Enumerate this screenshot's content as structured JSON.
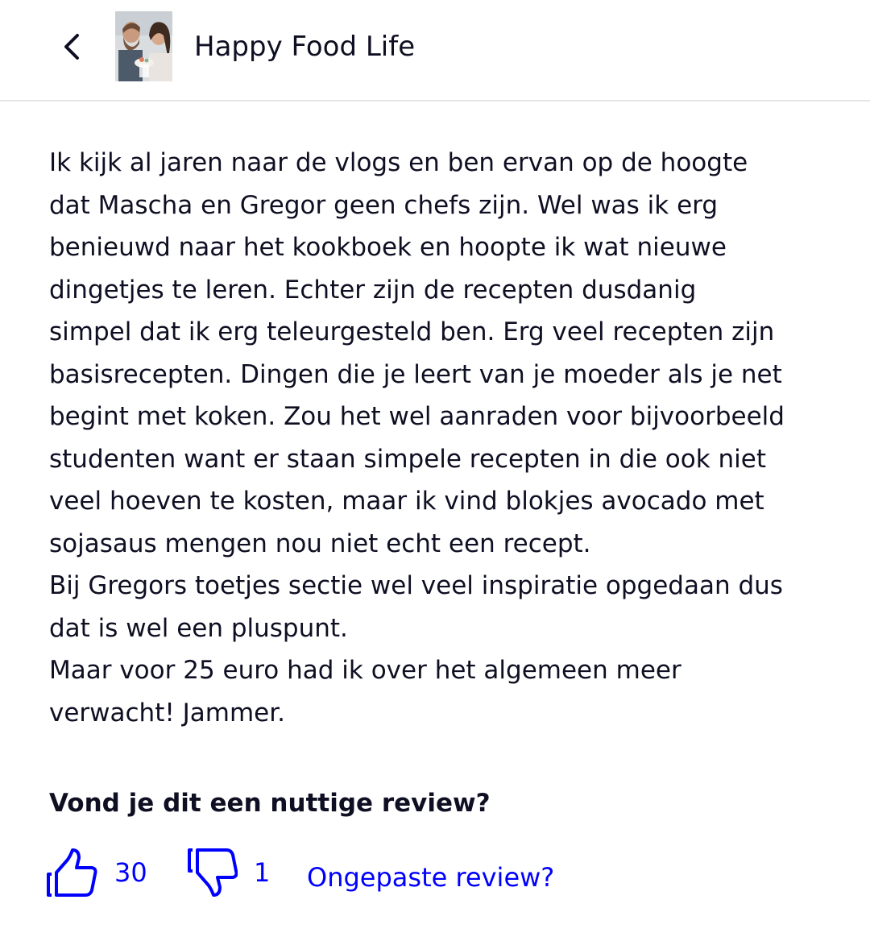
{
  "header": {
    "back_icon": "chevron-left-icon",
    "book_title": "Happy Food Life"
  },
  "review": {
    "lines": [
      "Ik kijk al jaren naar de vlogs en ben ervan op de hoogte",
      "dat Mascha en Gregor geen chefs zijn. Wel was ik erg",
      "benieuwd naar het kookboek en hoopte ik wat nieuwe",
      "dingetjes te leren. Echter zijn de recepten dusdanig",
      "simpel dat ik erg teleurgesteld ben. Erg veel recepten zijn",
      "basisrecepten. Dingen die je leert van je moeder als je net",
      "begint met koken. Zou het wel aanraden voor bijvoorbeeld",
      "studenten want er staan simpele recepten in die ook niet",
      "veel hoeven te kosten, maar ik vind blokjes avocado met",
      "sojasaus mengen nou niet echt een recept.",
      "Bij Gregors toetjes sectie wel veel inspiratie opgedaan dus",
      "dat is wel een pluspunt.",
      "Maar voor 25 euro had ik over het algemeen meer",
      "verwacht! Jammer."
    ]
  },
  "feedback": {
    "question": "Vond je dit een nuttige review?",
    "thumbs_up_icon": "thumbs-up-icon",
    "thumbs_down_icon": "thumbs-down-icon",
    "upvotes": "30",
    "downvotes": "1",
    "report_label": "Ongepaste review?"
  },
  "colors": {
    "text": "#0f0f23",
    "link": "#0000ff",
    "divider": "#e6e6e6"
  }
}
